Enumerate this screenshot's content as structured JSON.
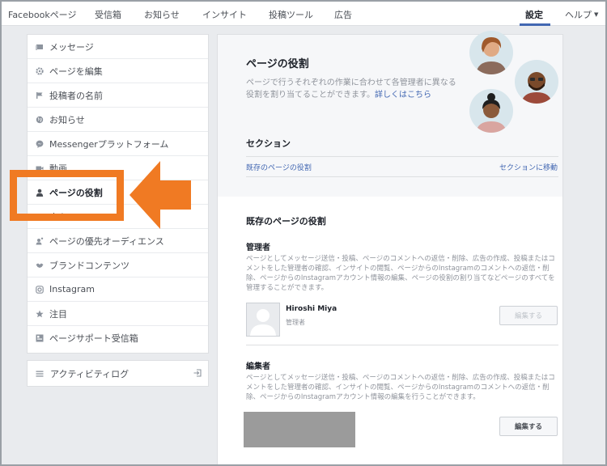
{
  "topnav": {
    "items": [
      "Facebookページ",
      "受信箱",
      "お知らせ",
      "インサイト",
      "投稿ツール",
      "広告"
    ],
    "settings": "設定",
    "help": "ヘルプ"
  },
  "sidebar": {
    "items": [
      {
        "label": "メッセージ",
        "icon": "message-icon"
      },
      {
        "label": "ページを編集",
        "icon": "gear-icon"
      },
      {
        "label": "投稿者の名前",
        "icon": "flag-icon"
      },
      {
        "label": "お知らせ",
        "icon": "globe-icon"
      },
      {
        "label": "Messengerプラットフォーム",
        "icon": "messenger-icon"
      },
      {
        "label": "動画",
        "icon": "video-icon"
      },
      {
        "label": "ページの役割",
        "icon": "person-icon"
      },
      {
        "label": "人々",
        "icon": "people-icon"
      },
      {
        "label": "ページの優先オーディエンス",
        "icon": "audience-icon"
      },
      {
        "label": "ブランドコンテンツ",
        "icon": "handshake-icon"
      },
      {
        "label": "Instagram",
        "icon": "instagram-icon"
      },
      {
        "label": "注目",
        "icon": "star-icon"
      },
      {
        "label": "ページサポート受信箱",
        "icon": "inbox-icon"
      }
    ],
    "activity_log": "アクティビティログ"
  },
  "main": {
    "title": "ページの役割",
    "description": "ページで行うそれぞれの作業に合わせて各管理者に異なる役割を割り当てることができます。",
    "learn_more": "詳しくはこちら",
    "section_label": "セクション",
    "section_link": "既存のページの役割",
    "section_jump": "セクションに移動",
    "existing_title": "既存のページの役割",
    "admin": {
      "title": "管理者",
      "description": "ページとしてメッセージ送信・投稿、ページのコメントへの返信・削除、広告の作成、投稿またはコメントをした管理者の確認、インサイトの閲覧、ページからのInstagramのコメントへの返信・削除、ページからのInstagramアカウント情報の編集、ページの役割の割り当てなどページのすべてを管理することができます。",
      "user_name": "Hiroshi Miya",
      "user_role": "管理者",
      "button": "編集する"
    },
    "editor": {
      "title": "編集者",
      "description": "ページとしてメッセージ送信・投稿、ページのコメントへの返信・削除、広告の作成、投稿またはコメントをした管理者の確認、インサイトの閲覧、ページからのInstagramのコメントへの返信・削除、ページからのInstagramアカウント情報の編集を行うことができます。",
      "button": "編集する"
    }
  },
  "colors": {
    "accent": "#4267b2",
    "highlight": "#f07a23"
  }
}
